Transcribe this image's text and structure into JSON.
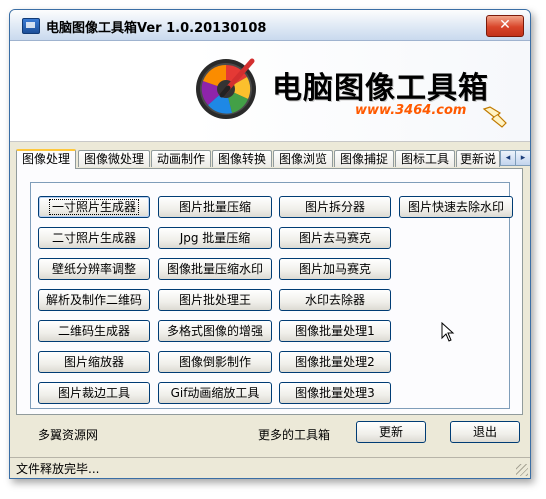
{
  "window": {
    "title": "电脑图像工具箱Ver 1.0.20130108",
    "close_glyph": "✕"
  },
  "banner": {
    "title": "电脑图像工具箱",
    "url": "www.3464.com"
  },
  "tabs": [
    {
      "label": "图像处理",
      "active": true
    },
    {
      "label": "图像微处理",
      "active": false
    },
    {
      "label": "动画制作",
      "active": false
    },
    {
      "label": "图像转换",
      "active": false
    },
    {
      "label": "图像浏览",
      "active": false
    },
    {
      "label": "图像捕捉",
      "active": false
    },
    {
      "label": "图标工具",
      "active": false
    },
    {
      "label": "更新说",
      "active": false
    }
  ],
  "tab_scroll": {
    "left": "◂",
    "right": "▸"
  },
  "tools": {
    "col1": [
      "一寸照片生成器",
      "二寸照片生成器",
      "壁纸分辨率调整",
      "解析及制作二维码",
      "二维码生成器",
      "图片缩放器",
      "图片裁边工具"
    ],
    "col2": [
      "图片批量压缩",
      "Jpg 批量压缩",
      "图像批量压缩水印",
      "图片批处理王",
      "多格式图像的增强",
      "图像倒影制作",
      "Gif动画缩放工具"
    ],
    "col3": [
      "图片拆分器",
      "图片去马赛克",
      "图片加马赛克",
      "水印去除器",
      "图像批量处理1",
      "图像批量处理2",
      "图像批量处理3"
    ],
    "col4": [
      "图片快速去除水印"
    ]
  },
  "footer": {
    "link_left": "多翼资源网",
    "link_more": "更多的工具箱",
    "update_button": "更新",
    "exit_button": "退出"
  },
  "status": {
    "text": "文件释放完毕..."
  }
}
